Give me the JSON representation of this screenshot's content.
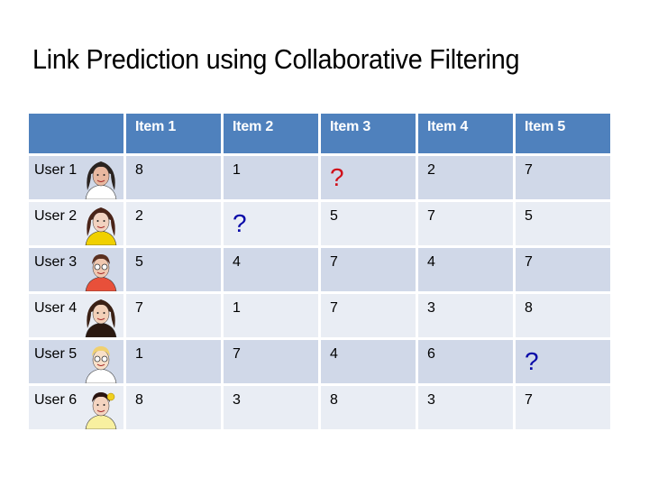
{
  "title": "Link Prediction using Collaborative Filtering",
  "colors": {
    "header_bg": "#4f81bd",
    "row_odd_bg": "#d0d8e8",
    "row_even_bg": "#e9edf4",
    "target_question": "#d0101a",
    "other_question": "#0a0aa8"
  },
  "table": {
    "corner": "",
    "columns": [
      "Item 1",
      "Item 2",
      "Item 3",
      "Item 4",
      "Item 5"
    ],
    "rows": [
      {
        "user": "User 1",
        "avatar": "woman-dark-wavy-hair-avatar",
        "values": [
          "8",
          "1",
          "?",
          "2",
          "7"
        ],
        "unknown_style": [
          "",
          "",
          "red",
          "",
          ""
        ]
      },
      {
        "user": "User 2",
        "avatar": "woman-smiling-yellow-top-avatar",
        "values": [
          "2",
          "?",
          "5",
          "7",
          "5"
        ],
        "unknown_style": [
          "",
          "blue",
          "",
          "",
          ""
        ]
      },
      {
        "user": "User 3",
        "avatar": "woman-glasses-red-top-avatar",
        "values": [
          "5",
          "4",
          "7",
          "4",
          "7"
        ],
        "unknown_style": [
          "",
          "",
          "",
          "",
          ""
        ]
      },
      {
        "user": "User 4",
        "avatar": "woman-curly-hair-smiling-avatar",
        "values": [
          "7",
          "1",
          "7",
          "3",
          "8"
        ],
        "unknown_style": [
          "",
          "",
          "",
          "",
          ""
        ]
      },
      {
        "user": "User 5",
        "avatar": "woman-blonde-sunglasses-avatar",
        "values": [
          "1",
          "7",
          "4",
          "6",
          "?"
        ],
        "unknown_style": [
          "",
          "",
          "",
          "",
          "blue"
        ]
      },
      {
        "user": "User 6",
        "avatar": "woman-flower-in-hair-avatar",
        "values": [
          "8",
          "3",
          "8",
          "3",
          "7"
        ],
        "unknown_style": [
          "",
          "",
          "",
          "",
          ""
        ]
      }
    ]
  }
}
